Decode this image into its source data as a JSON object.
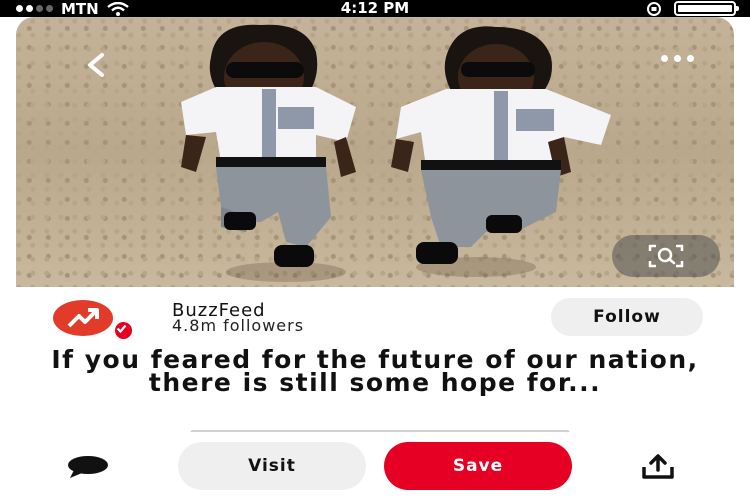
{
  "status_bar": {
    "carrier": "MTN",
    "time": "4:12 PM"
  },
  "pin": {
    "image_alt": "Twin boys in white shirts, grey trousers and sunglasses",
    "creator": {
      "name": "BuzzFeed",
      "followers": "4.8m followers"
    },
    "follow_label": "Follow",
    "title": "If you feared for the future of our nation, there is still some hope for..."
  },
  "actions": {
    "visit_label": "Visit",
    "save_label": "Save"
  },
  "colors": {
    "save": "#e60023",
    "avatar": "#e23b2a"
  },
  "icons": [
    "back-icon",
    "more-icon",
    "visual-search-icon",
    "comment-icon",
    "share-icon"
  ]
}
